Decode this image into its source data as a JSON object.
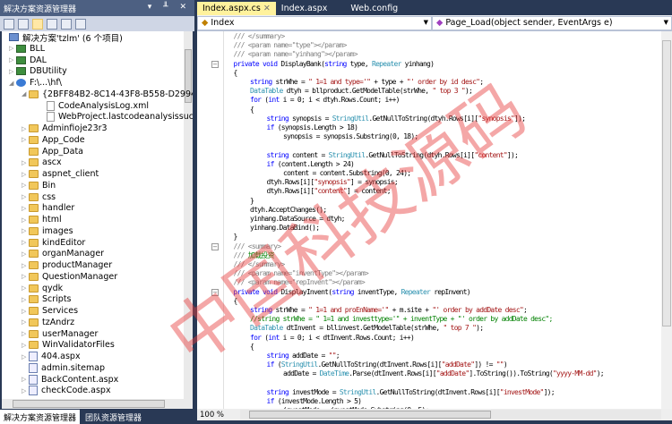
{
  "solution_explorer": {
    "title": "解决方案资源管理器",
    "controls": "▾ ╨ ✕",
    "items": [
      {
        "label": "解决方案'tzlm' (6 个项目)",
        "icon": "solution-icon",
        "level": 0,
        "exp": ""
      },
      {
        "label": "BLL",
        "icon": "csharp-project-icon",
        "level": 0,
        "exp": "▷"
      },
      {
        "label": "DAL",
        "icon": "csharp-project-icon",
        "level": 0,
        "exp": "▷"
      },
      {
        "label": "DBUtility",
        "icon": "csharp-project-icon",
        "level": 0,
        "exp": "▷"
      },
      {
        "label": "F:\\...\\hf\\",
        "icon": "website-icon",
        "level": 0,
        "exp": "◢"
      },
      {
        "label": "{2BFF84B2-8C14-43F8-B558-D2994315A829",
        "icon": "folder-open-icon",
        "level": 1,
        "exp": "◢"
      },
      {
        "label": "CodeAnalysisLog.xml",
        "icon": "xml-file-icon",
        "level": 2,
        "exp": ""
      },
      {
        "label": "WebProject.lastcodeanalysissucceeded",
        "icon": "file-icon",
        "level": 2,
        "exp": ""
      },
      {
        "label": "Adminfioje23r3",
        "icon": "folder-icon",
        "level": 1,
        "exp": "▷"
      },
      {
        "label": "App_Code",
        "icon": "folder-icon",
        "level": 1,
        "exp": "▷"
      },
      {
        "label": "App_Data",
        "icon": "folder-icon",
        "level": 1,
        "exp": ""
      },
      {
        "label": "ascx",
        "icon": "folder-icon",
        "level": 1,
        "exp": "▷"
      },
      {
        "label": "aspnet_client",
        "icon": "folder-icon",
        "level": 1,
        "exp": "▷"
      },
      {
        "label": "Bin",
        "icon": "folder-icon",
        "level": 1,
        "exp": "▷"
      },
      {
        "label": "css",
        "icon": "folder-icon",
        "level": 1,
        "exp": "▷"
      },
      {
        "label": "handler",
        "icon": "folder-icon",
        "level": 1,
        "exp": "▷"
      },
      {
        "label": "html",
        "icon": "folder-icon",
        "level": 1,
        "exp": "▷"
      },
      {
        "label": "images",
        "icon": "folder-icon",
        "level": 1,
        "exp": "▷"
      },
      {
        "label": "kindEditor",
        "icon": "folder-icon",
        "level": 1,
        "exp": "▷"
      },
      {
        "label": "organManager",
        "icon": "folder-icon",
        "level": 1,
        "exp": "▷"
      },
      {
        "label": "productManager",
        "icon": "folder-icon",
        "level": 1,
        "exp": "▷"
      },
      {
        "label": "QuestionManager",
        "icon": "folder-icon",
        "level": 1,
        "exp": "▷"
      },
      {
        "label": "qydk",
        "icon": "folder-icon",
        "level": 1,
        "exp": "▷"
      },
      {
        "label": "Scripts",
        "icon": "folder-icon",
        "level": 1,
        "exp": "▷"
      },
      {
        "label": "Services",
        "icon": "folder-icon",
        "level": 1,
        "exp": "▷"
      },
      {
        "label": "tzAndrz",
        "icon": "folder-icon",
        "level": 1,
        "exp": "▷"
      },
      {
        "label": "userManager",
        "icon": "folder-icon",
        "level": 1,
        "exp": "▷"
      },
      {
        "label": "WinValidatorFiles",
        "icon": "folder-icon",
        "level": 1,
        "exp": "▷"
      },
      {
        "label": "404.aspx",
        "icon": "aspx-page-icon",
        "level": 1,
        "exp": "▷"
      },
      {
        "label": "admin.sitemap",
        "icon": "sitemap-icon",
        "level": 1,
        "exp": ""
      },
      {
        "label": "BackContent.aspx",
        "icon": "aspx-page-icon",
        "level": 1,
        "exp": "▷"
      },
      {
        "label": "checkCode.aspx",
        "icon": "aspx-page-icon",
        "level": 1,
        "exp": "▷"
      }
    ],
    "bottom_tabs": [
      "解决方案资源管理器",
      "团队资源管理器"
    ]
  },
  "editor": {
    "tabs": [
      {
        "label": "Index.aspx.cs",
        "active": true,
        "close": "✕"
      },
      {
        "label": "Index.aspx",
        "active": false
      },
      {
        "label": "Web.config",
        "active": false
      }
    ],
    "class_combo": "Index",
    "member_combo": "Page_Load(object sender, EventArgs e)",
    "zoom": "100 %",
    "lines": [
      {
        "i": 1,
        "s": [
          [
            "d",
            "/// </summary>"
          ]
        ]
      },
      {
        "i": 1,
        "s": [
          [
            "d",
            "/// <param name=\"type\"></param>"
          ]
        ]
      },
      {
        "i": 1,
        "s": [
          [
            "d",
            "/// <param name=\"yinhang\"></param>"
          ]
        ]
      },
      {
        "i": 1,
        "f": "⊟",
        "s": [
          [
            "k",
            "private void "
          ],
          [
            "",
            "DisplayBank("
          ],
          [
            "k",
            "string"
          ],
          [
            "",
            " type, "
          ],
          [
            "t",
            "Repeater"
          ],
          [
            "",
            " yinhang)"
          ]
        ]
      },
      {
        "i": 1,
        "s": [
          [
            "",
            "{"
          ]
        ]
      },
      {
        "i": 2,
        "s": [
          [
            "k",
            "string"
          ],
          [
            "",
            " strWhe = "
          ],
          [
            "s",
            "\" 1=1 and type='\""
          ],
          [
            "",
            " + type + "
          ],
          [
            "s",
            "\"' order by id desc\""
          ],
          [
            "",
            ";"
          ]
        ]
      },
      {
        "i": 2,
        "s": [
          [
            "t",
            "DataTable"
          ],
          [
            "",
            " dtyh = bllproduct.GetModelTable(strWhe, "
          ],
          [
            "s",
            "\" top 3 \""
          ],
          [
            "",
            ");"
          ]
        ]
      },
      {
        "i": 2,
        "s": [
          [
            "k",
            "for"
          ],
          [
            "",
            " ("
          ],
          [
            "k",
            "int"
          ],
          [
            "",
            " i = 0; i < dtyh.Rows.Count; i++)"
          ]
        ]
      },
      {
        "i": 2,
        "s": [
          [
            "",
            "{"
          ]
        ]
      },
      {
        "i": 3,
        "s": [
          [
            "k",
            "string"
          ],
          [
            "",
            " synopsis = "
          ],
          [
            "t",
            "StringUtil"
          ],
          [
            "",
            ".GetNullToString(dtyh.Rows[i]["
          ],
          [
            "s",
            "\"synopsis\""
          ],
          [
            "",
            "]);"
          ]
        ]
      },
      {
        "i": 3,
        "s": [
          [
            "k",
            "if"
          ],
          [
            "",
            " (synopsis.Length > 18)"
          ]
        ]
      },
      {
        "i": 4,
        "s": [
          [
            "",
            "synopsis = synopsis.Substring(0, 18);"
          ]
        ]
      },
      {
        "i": 0,
        "s": [
          [
            "",
            ""
          ]
        ]
      },
      {
        "i": 3,
        "s": [
          [
            "k",
            "string"
          ],
          [
            "",
            " content = "
          ],
          [
            "t",
            "StringUtil"
          ],
          [
            "",
            ".GetNullToString(dtyh.Rows[i]["
          ],
          [
            "s",
            "\"content\""
          ],
          [
            "",
            "]);"
          ]
        ]
      },
      {
        "i": 3,
        "s": [
          [
            "k",
            "if"
          ],
          [
            "",
            " (content.Length > 24)"
          ]
        ]
      },
      {
        "i": 4,
        "s": [
          [
            "",
            "content = content.Substring(0, 24);"
          ]
        ]
      },
      {
        "i": 3,
        "s": [
          [
            "",
            "dtyh.Rows[i]["
          ],
          [
            "s",
            "\"synopsis\""
          ],
          [
            "",
            "] = synopsis;"
          ]
        ]
      },
      {
        "i": 3,
        "s": [
          [
            "",
            "dtyh.Rows[i]["
          ],
          [
            "s",
            "\"content\""
          ],
          [
            "",
            "] = content;"
          ]
        ]
      },
      {
        "i": 2,
        "s": [
          [
            "",
            "}"
          ]
        ]
      },
      {
        "i": 2,
        "s": [
          [
            "",
            "dtyh.AcceptChanges();"
          ]
        ]
      },
      {
        "i": 2,
        "s": [
          [
            "",
            "yinhang.DataSource = dtyh;"
          ]
        ]
      },
      {
        "i": 2,
        "s": [
          [
            "",
            "yinhang.DataBind();"
          ]
        ]
      },
      {
        "i": 1,
        "s": [
          [
            "",
            "}"
          ]
        ]
      },
      {
        "i": 1,
        "f": "⊟",
        "s": [
          [
            "d",
            "/// <summary>"
          ]
        ]
      },
      {
        "i": 1,
        "s": [
          [
            "d",
            "/// "
          ],
          [
            "c",
            "加载投资"
          ]
        ]
      },
      {
        "i": 1,
        "s": [
          [
            "d",
            "/// </summary>"
          ]
        ]
      },
      {
        "i": 1,
        "s": [
          [
            "d",
            "/// <param name=\"inventType\"></param>"
          ]
        ]
      },
      {
        "i": 1,
        "s": [
          [
            "d",
            "/// <param name=\"repInvent\"></param>"
          ]
        ]
      },
      {
        "i": 1,
        "f": "⊟",
        "s": [
          [
            "k",
            "private void "
          ],
          [
            "",
            "DisplayInvent("
          ],
          [
            "k",
            "string"
          ],
          [
            "",
            " inventType, "
          ],
          [
            "t",
            "Repeater"
          ],
          [
            "",
            " repInvent)"
          ]
        ]
      },
      {
        "i": 1,
        "s": [
          [
            "",
            "{"
          ]
        ]
      },
      {
        "i": 2,
        "s": [
          [
            "k",
            "string"
          ],
          [
            "",
            " strWhe = "
          ],
          [
            "s",
            "\" 1=1 and proEnName='\""
          ],
          [
            "",
            " + m.site + "
          ],
          [
            "s",
            "\"' order by addDate desc\""
          ],
          [
            "",
            ";"
          ]
        ]
      },
      {
        "i": 2,
        "s": [
          [
            "c",
            "//string strWhe = \" 1=1 and investtype='\" + inventType + \"' order by addDate desc\";"
          ]
        ]
      },
      {
        "i": 2,
        "s": [
          [
            "t",
            "DataTable"
          ],
          [
            "",
            " dtInvent = bllinvest.GetModelTable(strWhe, "
          ],
          [
            "s",
            "\" top 7 \""
          ],
          [
            "",
            ");"
          ]
        ]
      },
      {
        "i": 2,
        "s": [
          [
            "k",
            "for"
          ],
          [
            "",
            " ("
          ],
          [
            "k",
            "int"
          ],
          [
            "",
            " i = 0; i < dtInvent.Rows.Count; i++)"
          ]
        ]
      },
      {
        "i": 2,
        "s": [
          [
            "",
            "{"
          ]
        ]
      },
      {
        "i": 3,
        "s": [
          [
            "k",
            "string"
          ],
          [
            "",
            " addDate = "
          ],
          [
            "s",
            "\"\""
          ],
          [
            "",
            ";"
          ]
        ]
      },
      {
        "i": 3,
        "s": [
          [
            "k",
            "if"
          ],
          [
            "",
            " ("
          ],
          [
            "t",
            "StringUtil"
          ],
          [
            "",
            ".GetNullToString(dtInvent.Rows[i]["
          ],
          [
            "s",
            "\"addDate\""
          ],
          [
            "",
            "]) != "
          ],
          [
            "s",
            "\"\""
          ],
          [
            "",
            ")"
          ]
        ]
      },
      {
        "i": 4,
        "s": [
          [
            "",
            "addDate = "
          ],
          [
            "t",
            "DateTime"
          ],
          [
            "",
            ".Parse(dtInvent.Rows[i]["
          ],
          [
            "s",
            "\"addDate\""
          ],
          [
            "",
            "].ToString()).ToString("
          ],
          [
            "s",
            "\"yyyy-MM-dd\""
          ],
          [
            "",
            ");"
          ]
        ]
      },
      {
        "i": 0,
        "s": [
          [
            "",
            ""
          ]
        ]
      },
      {
        "i": 3,
        "s": [
          [
            "k",
            "string"
          ],
          [
            "",
            " investMode = "
          ],
          [
            "t",
            "StringUtil"
          ],
          [
            "",
            ".GetNullToString(dtInvent.Rows[i]["
          ],
          [
            "s",
            "\"investMode\""
          ],
          [
            "",
            "]);"
          ]
        ]
      },
      {
        "i": 3,
        "s": [
          [
            "k",
            "if"
          ],
          [
            "",
            " (investMode.Length > 5)"
          ]
        ]
      },
      {
        "i": 4,
        "s": [
          [
            "",
            "investMode = investMode.Substring(0, 5);"
          ]
        ]
      }
    ]
  },
  "watermark": "中国科技源码",
  "colors": {
    "chrome": "#293955",
    "active_tab": "#fff29d",
    "keyword": "#0000ff",
    "type": "#2b91af",
    "string": "#a31515",
    "comment": "#008000"
  }
}
